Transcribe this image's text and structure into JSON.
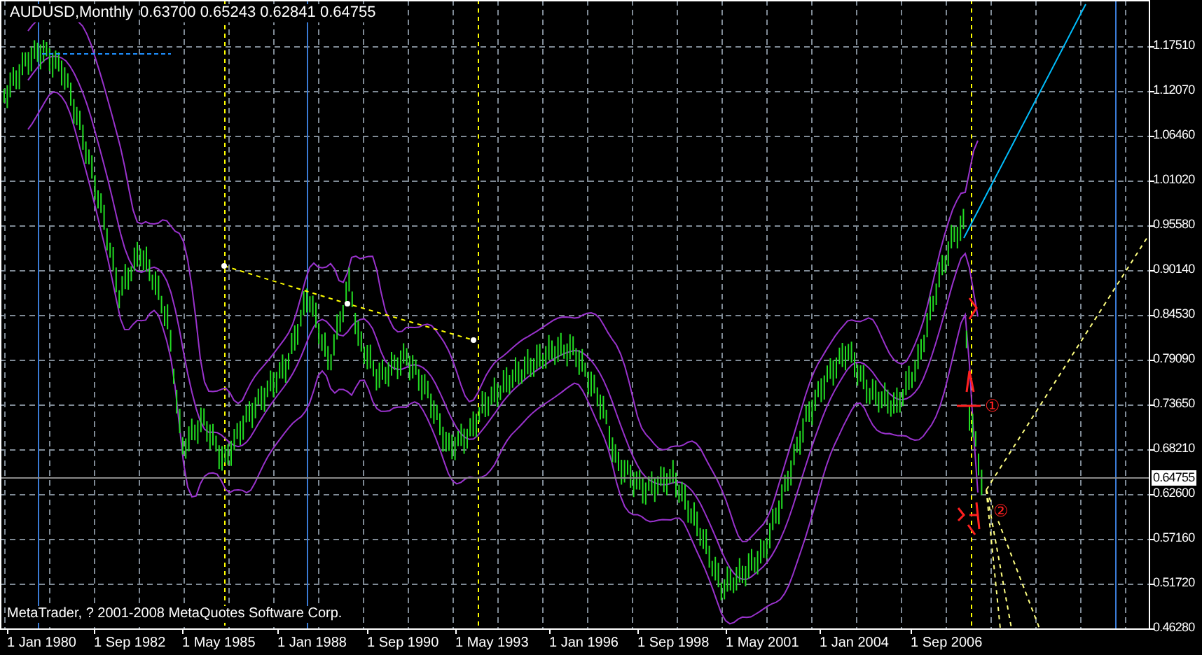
{
  "chart": {
    "symbol": "AUDUSD,Monthly",
    "ohlc": "0.63700 0.65243 0.62841 0.64755",
    "y_axis_labels": [
      "1.17510",
      "1.12070",
      "1.06460",
      "1.01020",
      "0.95580",
      "0.90140",
      "0.84530",
      "0.79090",
      "0.73650",
      "0.68210",
      "0.62600",
      "0.57160",
      "0.51720",
      "0.46280"
    ],
    "current_price": "0.64755",
    "x_axis_labels": [
      "1 Jan 1980",
      "1 Sep 1982",
      "1 May 1985",
      "1 Jan 1988",
      "1 Sep 1990",
      "1 May 1993",
      "1 Jan 1996",
      "1 Sep 1998",
      "1 May 2001",
      "1 Jan 2004",
      "1 Sep 2006"
    ],
    "wave_labels": [
      "①",
      "②"
    ],
    "copyright": "MetaTrader, ? 2001-2008 MetaQuotes Software Corp."
  }
}
